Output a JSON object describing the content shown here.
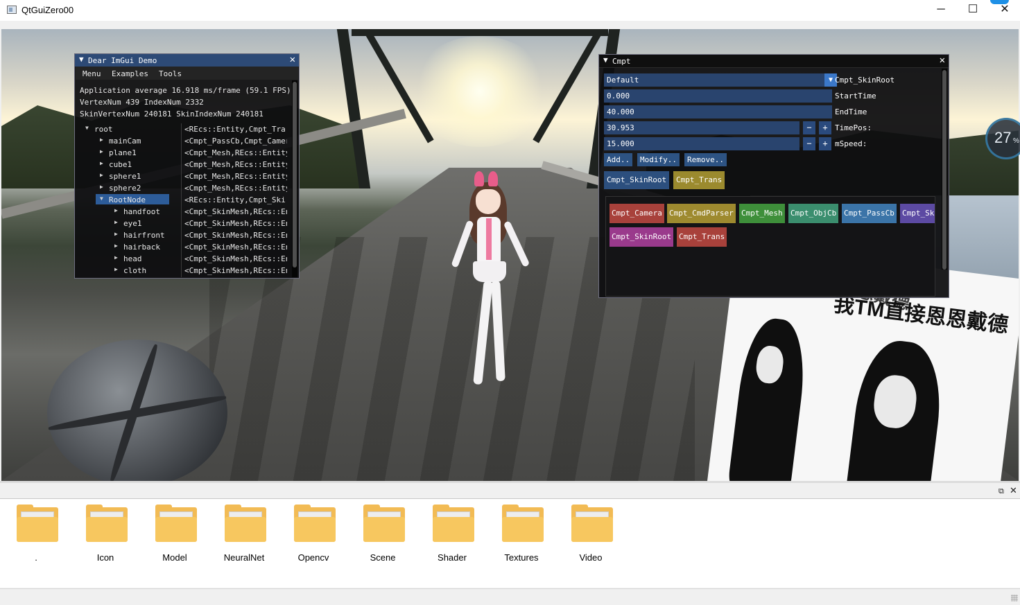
{
  "window": {
    "title": "QtGuiZero00",
    "minimize": "─",
    "maximize": "☐",
    "close": "✕"
  },
  "scene": {
    "gauge_value": "27",
    "gauge_unit": "%",
    "meme_text_1": "我TM直接恩恩戴德",
    "meme_text_2": "我TM直接恩恩戴德"
  },
  "demo": {
    "title": "Dear ImGui Demo",
    "menu": [
      "Menu",
      "Examples",
      "Tools"
    ],
    "stats": [
      "Application average 16.918 ms/frame (59.1 FPS)",
      "VertexNum 439 IndexNum 2332",
      "SkinVertexNum 240181 SkinIndexNum 240181"
    ],
    "tree": [
      {
        "label": "root",
        "value": "<REcs::Entity,Cmpt_Tra",
        "expanded": true
      },
      {
        "label": "mainCam",
        "value": "<Cmpt_PassCb,Cmpt_Camer"
      },
      {
        "label": "plane1",
        "value": "<Cmpt_Mesh,REcs::Entity"
      },
      {
        "label": "cube1",
        "value": "<Cmpt_Mesh,REcs::Entity"
      },
      {
        "label": "sphere1",
        "value": "<Cmpt_Mesh,REcs::Entity"
      },
      {
        "label": "sphere2",
        "value": "<Cmpt_Mesh,REcs::Entity"
      },
      {
        "label": "RootNode",
        "value": "<REcs::Entity,Cmpt_Ski",
        "expanded": true,
        "selected": true
      },
      {
        "label": "handfoot",
        "value": "<Cmpt_SkinMesh,REcs::En"
      },
      {
        "label": "eye1",
        "value": "<Cmpt_SkinMesh,REcs::En"
      },
      {
        "label": "hairfront",
        "value": "<Cmpt_SkinMesh,REcs::En"
      },
      {
        "label": "hairback",
        "value": "<Cmpt_SkinMesh,REcs::En"
      },
      {
        "label": "head",
        "value": "<Cmpt_SkinMesh,REcs::En"
      },
      {
        "label": "cloth",
        "value": "<Cmpt_SkinMesh,REcs::En"
      }
    ]
  },
  "cmpt": {
    "title": "Cmpt",
    "dropdown": {
      "value": "Default",
      "label": "Cmpt_SkinRoot"
    },
    "fields": [
      {
        "value": "0.000",
        "label": "StartTime"
      },
      {
        "value": "40.000",
        "label": "EndTime"
      }
    ],
    "steppers": [
      {
        "value": "30.953",
        "label": "TimePos:"
      },
      {
        "value": "15.000",
        "label": "mSpeed:"
      }
    ],
    "stepper_minus": "−",
    "stepper_plus": "+",
    "actions": [
      "Add..",
      "Modify..",
      "Remove.."
    ],
    "tabs": [
      "Cmpt_SkinRoot",
      "Cmpt_Trans"
    ],
    "tab_colors": [
      "#2c4f7e",
      "#9b8a2e"
    ],
    "available": [
      {
        "name": "Cmpt_Camera",
        "color": "#a8413b"
      },
      {
        "name": "Cmpt_CmdParser",
        "color": "#9e8a2f"
      },
      {
        "name": "Cmpt_Mesh",
        "color": "#3e8f3a"
      },
      {
        "name": "Cmpt_ObjCb",
        "color": "#3b8e6e"
      },
      {
        "name": "Cmpt_PassCb",
        "color": "#3b74a8"
      },
      {
        "name": "Cmpt_Sk",
        "color": "#5c4aa3"
      },
      {
        "name": "Cmpt_SkinRoot",
        "color": "#9a3a8c"
      },
      {
        "name": "Cmpt_Trans",
        "color": "#a8413b"
      }
    ]
  },
  "files": {
    "float_icon": "⧉",
    "close_icon": "✕",
    "items": [
      ".",
      "Icon",
      "Model",
      "NeuralNet",
      "Opencv",
      "Scene",
      "Shader",
      "Textures",
      "Video"
    ]
  }
}
